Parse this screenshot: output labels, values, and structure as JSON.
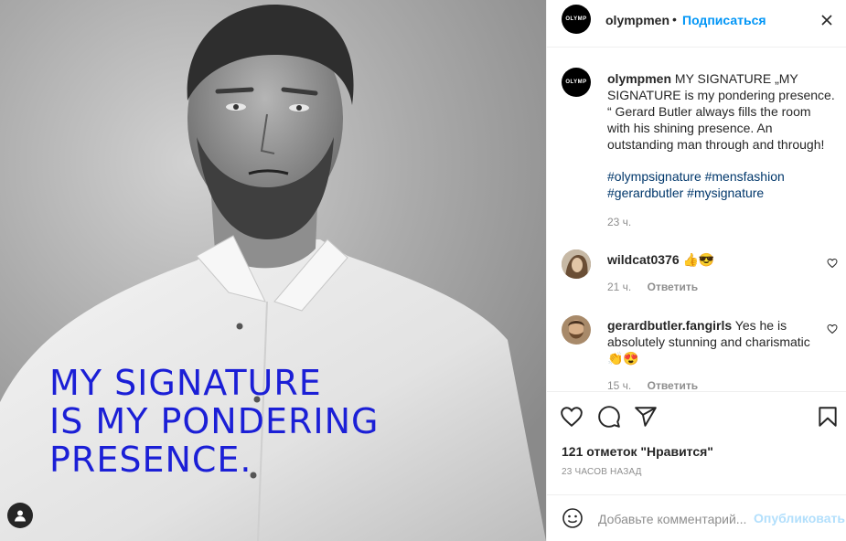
{
  "photo": {
    "overlay_lines": [
      "MY SIGNATURE",
      "IS MY PONDERING",
      "PRESENCE."
    ]
  },
  "header": {
    "logo_text": "OLYMP",
    "username": "olympmen",
    "separator": "•",
    "follow_label": "Подписаться"
  },
  "caption": {
    "username": "olympmen",
    "text": " MY SIGNATURE „MY SIGNATURE is my pondering presence. “ Gerard Butler always fills the room with his shining presence. An outstanding man through and through!",
    "hashtags": "#olympsignature #mensfashion #gerardbutler #mysignature",
    "time": "23 ч."
  },
  "comments": [
    {
      "username": "wildcat0376",
      "text": " 👍😎",
      "time": "21 ч.",
      "reply_label": "Ответить"
    },
    {
      "username": "gerardbutler.fangirls",
      "text": " Yes he is absolutely stunning and charismatic 👏😍",
      "time": "15 ч.",
      "reply_label": "Ответить"
    }
  ],
  "actions": {
    "likes_text": "121 отметок \"Нравится\"",
    "posted_ago": "23 ЧАСОВ НАЗАД"
  },
  "add_comment": {
    "placeholder": "Добавьте комментарий...",
    "publish_label": "Опубликовать"
  },
  "icons": [
    "user-tag-icon",
    "more-options-icon",
    "heart-icon",
    "comment-icon",
    "share-icon",
    "bookmark-icon",
    "emoji-icon"
  ],
  "colors": {
    "accent": "#0095f6",
    "overlay_text": "#1b1fd6",
    "hashtag": "#00376b",
    "muted": "#8e8e8e"
  }
}
